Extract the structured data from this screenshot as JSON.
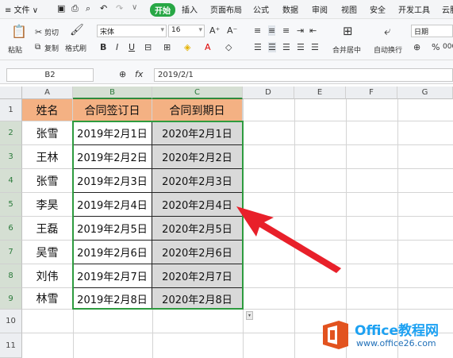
{
  "menubar": {
    "file": "≡ 文件 ∨",
    "start": "开始",
    "items": [
      "插入",
      "页面布局",
      "公式",
      "数据",
      "审阅",
      "视图",
      "安全",
      "开发工具",
      "云服"
    ]
  },
  "ribbon": {
    "paste": "粘贴",
    "cut": "剪切",
    "copy": "复制",
    "format_painter": "格式刷",
    "font_name": "宋体",
    "font_size": "16",
    "merge_center": "合并居中",
    "wrap_text": "自动换行",
    "number_format": "日期",
    "percent_label": "%",
    "comma_label": "000"
  },
  "formula_bar": {
    "cell_ref": "B2",
    "fx": "fx",
    "content": "2019/2/1"
  },
  "columns": [
    "A",
    "B",
    "C",
    "D",
    "E",
    "F",
    "G"
  ],
  "rows": [
    "1",
    "2",
    "3",
    "4",
    "5",
    "6",
    "7",
    "8",
    "9",
    "10",
    "11"
  ],
  "table": {
    "headers": [
      "姓名",
      "合同签订日",
      "合同到期日"
    ],
    "rows": [
      [
        "张雪",
        "2019年2月1日",
        "2020年2月1日"
      ],
      [
        "王林",
        "2019年2月2日",
        "2020年2月2日"
      ],
      [
        "张雪",
        "2019年2月3日",
        "2020年2月3日"
      ],
      [
        "李昊",
        "2019年2月4日",
        "2020年2月4日"
      ],
      [
        "王磊",
        "2019年2月5日",
        "2020年2月5日"
      ],
      [
        "吴雪",
        "2019年2月6日",
        "2020年2月6日"
      ],
      [
        "刘伟",
        "2019年2月7日",
        "2020年2月7日"
      ],
      [
        "林雪",
        "2019年2月8日",
        "2020年2月8日"
      ]
    ]
  },
  "watermark": {
    "brand": "Office教程网",
    "url": "www.office26.com"
  },
  "colors": {
    "header_fill": "#f4b183",
    "selection_border": "#2e9b3f",
    "c_fill": "#d9d9d9",
    "arrow": "#e8202a",
    "start_tab": "#28a745"
  }
}
